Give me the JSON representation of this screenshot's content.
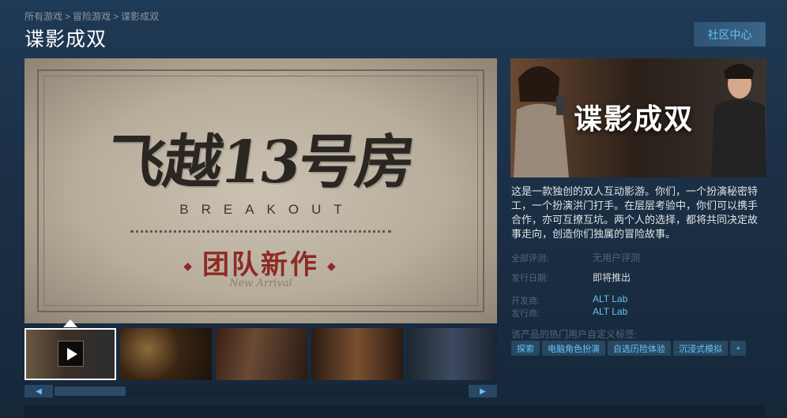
{
  "breadcrumb": {
    "items": [
      "所有游戏",
      "冒险游戏",
      "谍影成双"
    ],
    "separator": ">"
  },
  "page": {
    "title": "谍影成双"
  },
  "header": {
    "community_button": "社区中心"
  },
  "main_media": {
    "logo_cn": "飞越13号房",
    "logo_en": "BREAKOUT",
    "subtitle": "团队新作",
    "subtitle_ornament": "◆",
    "signature": "New Arrival"
  },
  "thumbnails": [
    {
      "kind": "video",
      "selected": true
    },
    {
      "kind": "image"
    },
    {
      "kind": "image"
    },
    {
      "kind": "image"
    },
    {
      "kind": "image"
    }
  ],
  "slider": {
    "prev": "◀",
    "next": "▶"
  },
  "capsule": {
    "title": "谍影成双"
  },
  "description": "这是一款独创的双人互动影游。你们，一个扮演秘密特工，一个扮演洪门打手。在层层考验中，你们可以携手合作，亦可互撩互坑。两个人的选择，都将共同决定故事走向，创造你们独属的冒险故事。",
  "info": {
    "reviews_label": "全部评测:",
    "reviews_value": "无用户评测",
    "release_label": "发行日期:",
    "release_value": "即将推出",
    "developer_label": "开发商:",
    "developer_value": "ALT Lab",
    "publisher_label": "发行商:",
    "publisher_value": "ALT Lab"
  },
  "tags": {
    "title": "该产品的热门用户自定义标签:",
    "items": [
      "探索",
      "电脑角色扮演",
      "自选历险体验",
      "沉浸式模拟"
    ],
    "more": "+"
  },
  "colors": {
    "accent": "#67c1f5",
    "button_bg": "#2f5373",
    "tag_bg": "#2a475e"
  }
}
